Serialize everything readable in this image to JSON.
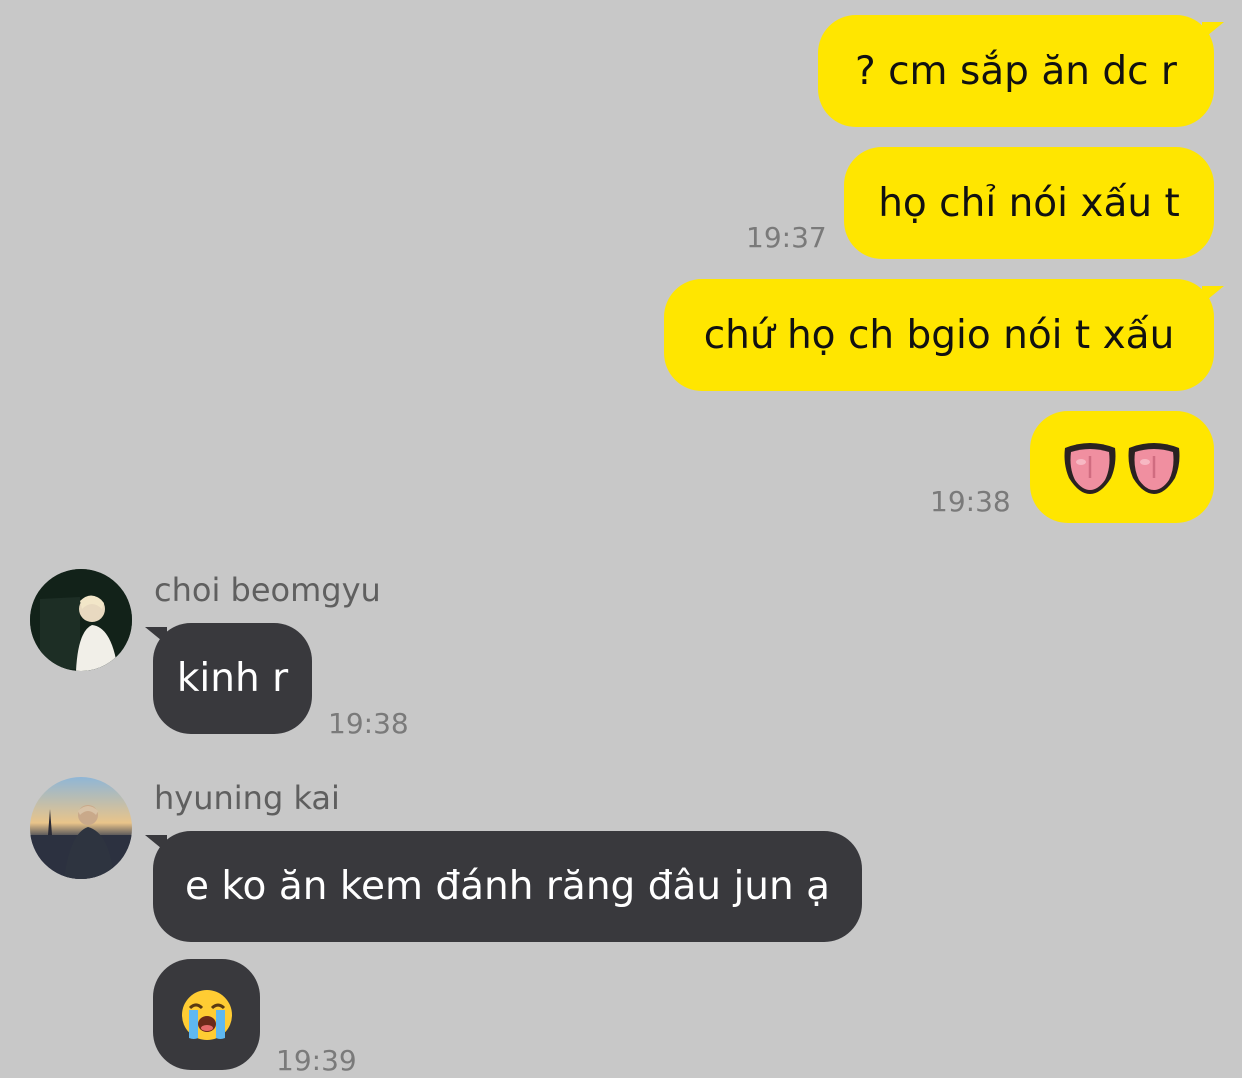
{
  "colors": {
    "background": "#c8c8c8",
    "my_bubble": "#ffe600",
    "their_bubble": "#39393d",
    "timestamp": "#7a7a7a",
    "sender_name": "#5f5f5f"
  },
  "messages": {
    "m1": {
      "text": "? cm sắp ăn dc r"
    },
    "m2": {
      "text": "họ chỉ nói xấu t",
      "time": "19:37"
    },
    "m3": {
      "text": "chứ họ ch bgio nói t xấu"
    },
    "m4": {
      "emoji": [
        "tongue-emoji",
        "tongue-emoji"
      ],
      "time": "19:38"
    },
    "m5": {
      "sender": "choi beomgyu",
      "text": "kinh r",
      "time": "19:38"
    },
    "m6": {
      "sender": "hyuning kai",
      "text": "e ko ăn kem đánh răng đâu jun ạ"
    },
    "m7": {
      "emoji": [
        "loudly-crying-face-emoji"
      ],
      "time": "19:39"
    }
  }
}
